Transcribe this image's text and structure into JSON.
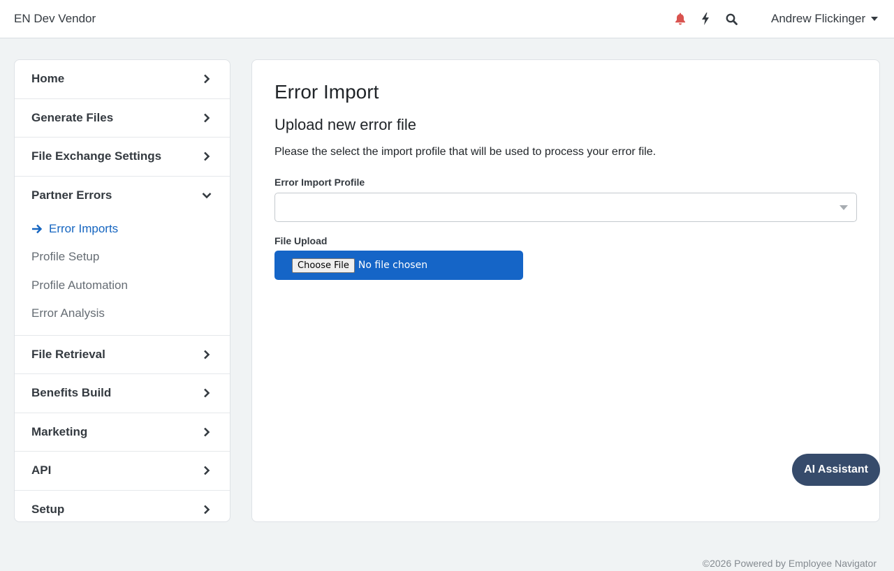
{
  "header": {
    "brand": "EN Dev Vendor",
    "user_name": "Andrew Flickinger",
    "icons": [
      "bell-icon",
      "bolt-icon",
      "search-icon"
    ],
    "bell_color": "#d9534f"
  },
  "sidebar": {
    "items_top": [
      {
        "label": "Home"
      },
      {
        "label": "Generate Files"
      },
      {
        "label": "File Exchange Settings"
      }
    ],
    "group": {
      "label": "Partner Errors",
      "expanded": true,
      "children": [
        {
          "label": "Error Imports",
          "active": true
        },
        {
          "label": "Profile Setup"
        },
        {
          "label": "Profile Automation"
        },
        {
          "label": "Error Analysis"
        }
      ]
    },
    "items_bottom": [
      {
        "label": "File Retrieval"
      },
      {
        "label": "Benefits Build"
      },
      {
        "label": "Marketing"
      },
      {
        "label": "API"
      },
      {
        "label": "Setup"
      }
    ]
  },
  "main": {
    "title": "Error Import",
    "section_title": "Upload new error file",
    "instructions": "Please the select the import profile that will be used to process your error file.",
    "profile_label": "Error Import Profile",
    "profile_value": "",
    "upload_label": "File Upload",
    "choose_file_label": "Choose File",
    "file_status": "No file chosen"
  },
  "ai_assistant_label": "AI Assistant",
  "footer": "©2026 Powered by Employee Navigator",
  "colors": {
    "accent": "#1565c0",
    "upload_bg": "#1565c7",
    "ai_button_bg": "#364b6b"
  }
}
